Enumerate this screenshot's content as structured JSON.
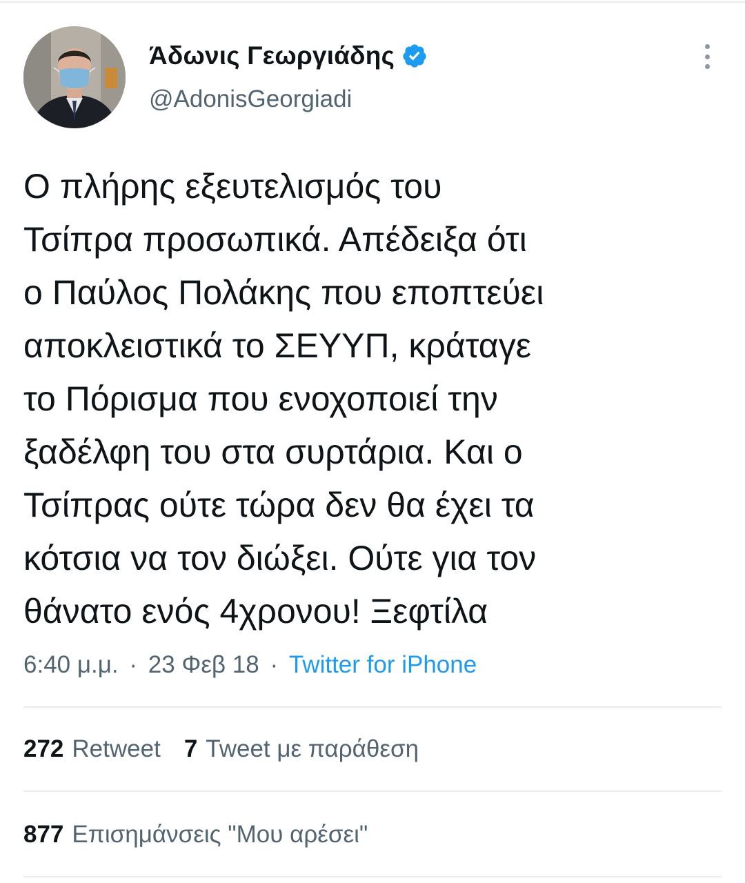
{
  "user": {
    "name": "Άδωνις Γεωργιάδης",
    "handle": "@AdonisGeorgiadi",
    "verified": true
  },
  "tweet": {
    "lines": [
      "Ο πλήρης εξευτελισμός του",
      "Τσίπρα προσωπικά. Απέδειξα ότι",
      "ο Παύλος Πολάκης που εποπτεύει",
      "αποκλειστικά το ΣΕΥΥΠ, κράταγε",
      "το Πόρισμα που ενοχοποιεί την",
      "ξαδέλφη του στα συρτάρια. Και ο",
      "Τσίπρας ούτε τώρα δεν θα έχει τα",
      "κότσια να τον διώξει. Ούτε για τον",
      "θάνατο ενός 4χρονου! Ξεφτίλα"
    ]
  },
  "meta": {
    "time": "6:40 μ.μ.",
    "separator": "·",
    "date": "23 Φεβ 18",
    "source": "Twitter for iPhone"
  },
  "stats": {
    "retweets_count": "272",
    "retweets_label": "Retweet",
    "quotes_count": "7",
    "quotes_label": "Tweet με παράθεση",
    "likes_count": "877",
    "likes_label": "Επισημάνσεις \"Μου αρέσει\""
  },
  "icons": {
    "verified": "verified-badge-icon",
    "more": "more-vertical-icon"
  },
  "colors": {
    "accent": "#1d9bf0",
    "secondary_text": "#536471",
    "divider": "#e6ecf0"
  }
}
